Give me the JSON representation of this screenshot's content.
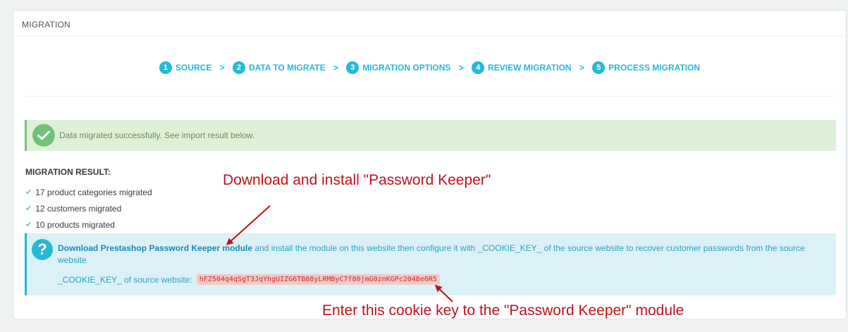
{
  "panel": {
    "heading": "MIGRATION"
  },
  "steps": [
    {
      "num": "1",
      "label": "SOURCE"
    },
    {
      "num": "2",
      "label": "DATA TO MIGRATE"
    },
    {
      "num": "3",
      "label": "MIGRATION OPTIONS"
    },
    {
      "num": "4",
      "label": "REVIEW MIGRATION"
    },
    {
      "num": "5",
      "label": "PROCESS MIGRATION"
    }
  ],
  "step_separator": ">",
  "success_alert": {
    "text": "Data migrated successfully. See import result below.",
    "icon": "check-circle-icon"
  },
  "result": {
    "title": "MIGRATION RESULT:",
    "items": [
      "17 product categories migrated",
      "12 customers migrated",
      "10 products migrated"
    ]
  },
  "info_alert": {
    "icon": "question-circle-icon",
    "link_text": "Download Prestashop Password Keeper module",
    "text": " and install the module on this website then configure it with _COOKIE_KEY_ of the source website to recover customer passwords from the source website",
    "cookie_label": "_COOKIE_KEY_ of source website:",
    "cookie_value": "hFZ504q4qSgT3JqYhgUIZG6TB08yLRMByC7f80jmG0znKGPc204Be6R5"
  },
  "annotations": {
    "top": "Download and install \"Password Keeper\"",
    "bottom": "Enter this cookie key to the \"Password Keeper\" module"
  },
  "colors": {
    "accent": "#25b9d7",
    "success": "#72c279",
    "annotation": "#c0121b"
  }
}
